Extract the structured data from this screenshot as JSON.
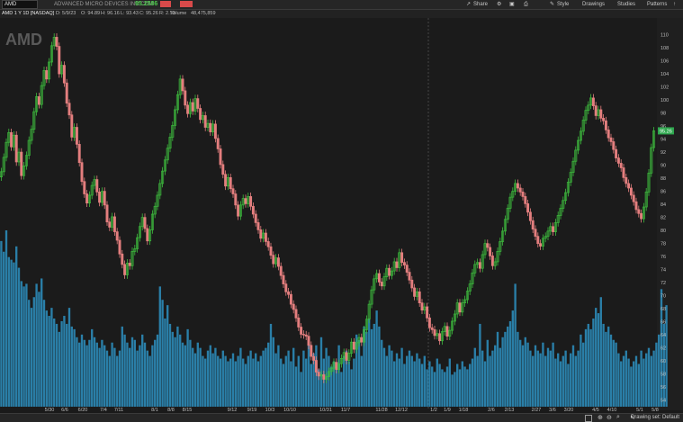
{
  "toolbar": {
    "symbol": "AMD",
    "company_name": "ADVANCED MICRO DEVICES INC COM",
    "last_price": "95.2586",
    "share_label": "Share",
    "style_label": "Style",
    "drawings_label": "Drawings",
    "studies_label": "Studies",
    "patterns_label": "Patterns"
  },
  "info": {
    "title": "AMD 1 Y 1D [NASDAQ]",
    "date": "D: 5/9/23",
    "open": "O: 94.89",
    "high": "H: 96.16",
    "low": "L: 93.43",
    "close": "C: 95.26",
    "range": "R: 2.73",
    "volume_label": "Volume",
    "volume_value": "48,475,859"
  },
  "watermark": "AMD",
  "status": {
    "drawing_set": "Drawing set: Default"
  },
  "colors": {
    "up": "#3dbb3d",
    "down": "#e47f7f",
    "volume": "#2a7fa8",
    "last_badge": "#2fa84f",
    "background": "#1a1a1a"
  },
  "chart_data": {
    "type": "candlestick",
    "title": "AMD 1 Y 1D [NASDAQ]",
    "x_tick_labels": [
      "5/30",
      "6/6",
      "6/20",
      "7/4",
      "7/11",
      "8/1",
      "8/8",
      "8/15",
      "9/12",
      "9/19",
      "10/3",
      "10/10",
      "10/31",
      "11/7",
      "11/28",
      "12/12",
      "1/2",
      "1/9",
      "1/18",
      "2/6",
      "2/13",
      "2/27",
      "3/6",
      "3/20",
      "4/5",
      "4/10",
      "5/1",
      "5/8"
    ],
    "y_ticks": [
      54,
      56,
      58,
      60,
      62,
      64,
      66,
      68,
      70,
      72,
      74,
      76,
      78,
      80,
      82,
      84,
      86,
      88,
      90,
      92,
      94,
      96,
      98,
      100,
      102,
      104,
      106,
      108,
      110
    ],
    "ylim": [
      53,
      112
    ],
    "last_price_label": "95.26",
    "series": [
      {
        "name": "Price",
        "close": [
          89.0,
          91.2,
          93.5,
          95.0,
          92.8,
          94.6,
          90.5,
          92.0,
          88.4,
          89.9,
          91.5,
          93.8,
          95.5,
          98.2,
          100.5,
          99.3,
          102.2,
          104.5,
          103.2,
          105.8,
          108.3,
          109.6,
          108.2,
          104.0,
          105.3,
          102.6,
          99.5,
          97.7,
          94.3,
          95.8,
          93.2,
          90.4,
          87.5,
          85.6,
          84.2,
          85.4,
          86.9,
          87.8,
          85.9,
          84.3,
          86.0,
          83.9,
          81.3,
          80.5,
          82.1,
          79.8,
          78.5,
          76.4,
          74.8,
          73.2,
          75.0,
          74.6,
          76.8,
          77.2,
          78.9,
          80.6,
          82.0,
          80.3,
          78.4,
          80.1,
          82.5,
          83.7,
          85.4,
          87.2,
          89.1,
          90.8,
          92.6,
          94.3,
          96.1,
          98.5,
          100.8,
          103.2,
          101.4,
          99.2,
          97.9,
          99.6,
          98.3,
          100.2,
          98.7,
          97.0,
          97.6,
          95.8,
          96.4,
          95.1,
          96.3,
          94.1,
          92.5,
          90.1,
          88.6,
          86.8,
          88.1,
          86.4,
          85.6,
          83.9,
          82.2,
          83.9,
          84.9,
          84.1,
          85.2,
          83.7,
          82.5,
          81.2,
          80.1,
          78.8,
          79.6,
          78.3,
          77.5,
          76.2,
          74.9,
          75.8,
          74.5,
          73.1,
          71.8,
          70.6,
          70.2,
          68.7,
          67.9,
          66.6,
          65.2,
          64.1,
          64.0,
          63.8,
          62.4,
          60.7,
          60.1,
          58.3,
          57.7,
          57.9,
          57.2,
          57.6,
          58.4,
          58.9,
          59.8,
          58.7,
          59.6,
          60.4,
          61.3,
          60.1,
          61.2,
          62.9,
          61.8,
          62.8,
          63.6,
          62.9,
          64.8,
          66.4,
          68.7,
          70.9,
          72.6,
          73.4,
          72.1,
          71.5,
          72.9,
          74.2,
          73.1,
          73.8,
          75.2,
          74.3,
          76.6,
          75.1,
          74.7,
          73.6,
          72.4,
          71.2,
          69.9,
          70.6,
          68.9,
          67.8,
          68.3,
          66.6,
          65.1,
          64.8,
          63.9,
          64.2,
          63.1,
          64.5,
          65.3,
          63.8,
          64.7,
          66.1,
          67.2,
          68.9,
          67.5,
          68.9,
          69.4,
          70.7,
          71.8,
          73.5,
          74.8,
          75.1,
          74.2,
          76.3,
          78.0,
          77.4,
          76.1,
          74.6,
          75.2,
          76.8,
          78.3,
          79.9,
          81.7,
          83.4,
          85.1,
          86.0,
          87.2,
          86.5,
          85.9,
          85.2,
          84.1,
          82.8,
          81.5,
          80.2,
          79.1,
          78.0,
          77.6,
          78.8,
          79.1,
          79.9,
          80.6,
          79.8,
          81.2,
          82.3,
          83.4,
          84.6,
          85.8,
          87.4,
          88.9,
          90.6,
          92.3,
          93.8,
          95.2,
          96.9,
          98.4,
          99.2,
          100.3,
          99.1,
          97.6,
          98.5,
          97.2,
          96.8,
          95.4,
          94.2,
          93.6,
          92.4,
          91.1,
          90.3,
          89.6,
          88.1,
          87.2,
          86.5,
          85.4,
          84.4,
          83.2,
          82.6,
          81.8,
          83.6,
          85.9,
          88.8,
          92.7,
          95.26
        ]
      },
      {
        "name": "Volume",
        "values": [
          62,
          58,
          66,
          56,
          55,
          54,
          60,
          52,
          47,
          45,
          46,
          40,
          37,
          41,
          46,
          43,
          48,
          40,
          36,
          34,
          37,
          33,
          31,
          28,
          32,
          34,
          31,
          37,
          30,
          29,
          26,
          24,
          27,
          25,
          23,
          25,
          29,
          26,
          24,
          22,
          25,
          23,
          21,
          19,
          24,
          22,
          19,
          21,
          30,
          27,
          24,
          22,
          26,
          25,
          21,
          23,
          27,
          24,
          21,
          19,
          23,
          25,
          27,
          45,
          40,
          33,
          38,
          31,
          28,
          26,
          30,
          27,
          24,
          23,
          29,
          25,
          22,
          20,
          24,
          22,
          19,
          18,
          21,
          23,
          20,
          22,
          19,
          18,
          21,
          19,
          17,
          18,
          20,
          17,
          19,
          22,
          18,
          16,
          19,
          21,
          18,
          20,
          17,
          19,
          21,
          22,
          24,
          31,
          26,
          20,
          23,
          18,
          16,
          19,
          21,
          17,
          22,
          15,
          19,
          13,
          21,
          18,
          24,
          16,
          20,
          23,
          14,
          26,
          18,
          22,
          19,
          15,
          17,
          16,
          23,
          13,
          19,
          21,
          17,
          14,
          18,
          27,
          25,
          19,
          30,
          28,
          33,
          29,
          31,
          36,
          30,
          25,
          22,
          19,
          23,
          21,
          17,
          20,
          18,
          22,
          16,
          19,
          21,
          19,
          17,
          20,
          18,
          16,
          19,
          14,
          17,
          15,
          13,
          18,
          16,
          14,
          13,
          15,
          18,
          12,
          13,
          16,
          14,
          17,
          15,
          14,
          16,
          18,
          22,
          19,
          31,
          21,
          17,
          25,
          19,
          21,
          23,
          28,
          22,
          26,
          28,
          30,
          32,
          36,
          46,
          28,
          25,
          23,
          26,
          24,
          21,
          19,
          23,
          21,
          20,
          24,
          19,
          22,
          21,
          24,
          18,
          20,
          17,
          19,
          21,
          16,
          20,
          23,
          19,
          21,
          27,
          24,
          29,
          31,
          29,
          33,
          37,
          35,
          41,
          31,
          28,
          30,
          27,
          25,
          24,
          20,
          17,
          19,
          21,
          18,
          15,
          17,
          19,
          16,
          21,
          18,
          20,
          22,
          19,
          21,
          24,
          27,
          44,
          31,
          38
        ]
      }
    ]
  }
}
